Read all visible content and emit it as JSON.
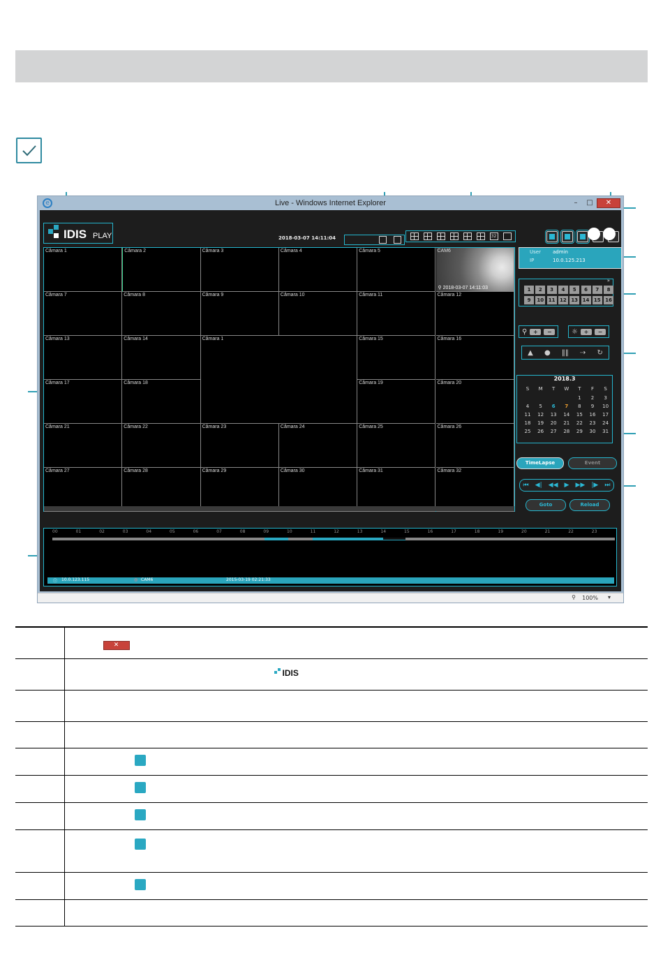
{
  "window": {
    "title": "Live - Windows Internet Explorer"
  },
  "app": {
    "logo_text": "IDIS",
    "logo_sub": "PLAY",
    "datetime": "2018-03-07 14:11:04"
  },
  "layout_last_label": "32",
  "user": {
    "user_label": "User",
    "user_value": "admin",
    "ip_label": "IP",
    "ip_value": "10.0.125.213"
  },
  "cameras": [
    "Câmara 1",
    "Câmara 2",
    "Câmara 3",
    "Câmara 4",
    "Câmara 5",
    "CAM6",
    "Câmara 7",
    "Câmara 8",
    "Câmara 9",
    "Câmara 10",
    "Câmara 11",
    "Câmara 12",
    "Câmara 13",
    "Câmara 14",
    "Câmara 1",
    "Câmara 15",
    "Câmara 16",
    "Câmara 17",
    "Câmara 18",
    "Câmara 19",
    "Câmara 20",
    "Câmara 21",
    "Câmara 22",
    "Câmara 23",
    "Câmara 24",
    "Câmara 25",
    "Câmara 26",
    "Câmara 27",
    "Câmara 28",
    "Câmara 29",
    "Câmara 30",
    "Câmara 31",
    "Câmara 32"
  ],
  "cam6_timestamp": "2018-03-07 14:11:03",
  "camera_buttons": [
    "1",
    "2",
    "3",
    "4",
    "5",
    "6",
    "7",
    "8",
    "9",
    "10",
    "11",
    "12",
    "13",
    "14",
    "15",
    "16"
  ],
  "calendar": {
    "title": "2018.3",
    "weekdays": [
      "S",
      "M",
      "T",
      "W",
      "T",
      "F",
      "S"
    ],
    "weeks": [
      [
        "",
        "",
        "",
        "",
        "1",
        "2",
        "3"
      ],
      [
        "4",
        "5",
        "6",
        "7",
        "8",
        "9",
        "10"
      ],
      [
        "11",
        "12",
        "13",
        "14",
        "15",
        "16",
        "17"
      ],
      [
        "18",
        "19",
        "20",
        "21",
        "22",
        "23",
        "24"
      ],
      [
        "25",
        "26",
        "27",
        "28",
        "29",
        "30",
        "31"
      ]
    ]
  },
  "buttons": {
    "timelapse": "TimeLapse",
    "event": "Event",
    "goto": "Goto",
    "reload": "Reload"
  },
  "timeline": {
    "hours": [
      "00",
      "01",
      "02",
      "03",
      "04",
      "05",
      "06",
      "07",
      "08",
      "09",
      "10",
      "11",
      "12",
      "13",
      "14",
      "15",
      "16",
      "17",
      "18",
      "19",
      "20",
      "21",
      "22",
      "23"
    ],
    "status_ip": "10.0.123.115",
    "status_cam": "CAM6",
    "status_time": "2015-03-19 02:21:33"
  },
  "statusbar": {
    "zoom": "100%"
  },
  "legend_rows": 10,
  "colors": {
    "accent": "#25b7cf",
    "close": "#c8423a",
    "header_gray": "#d3d4d5"
  }
}
